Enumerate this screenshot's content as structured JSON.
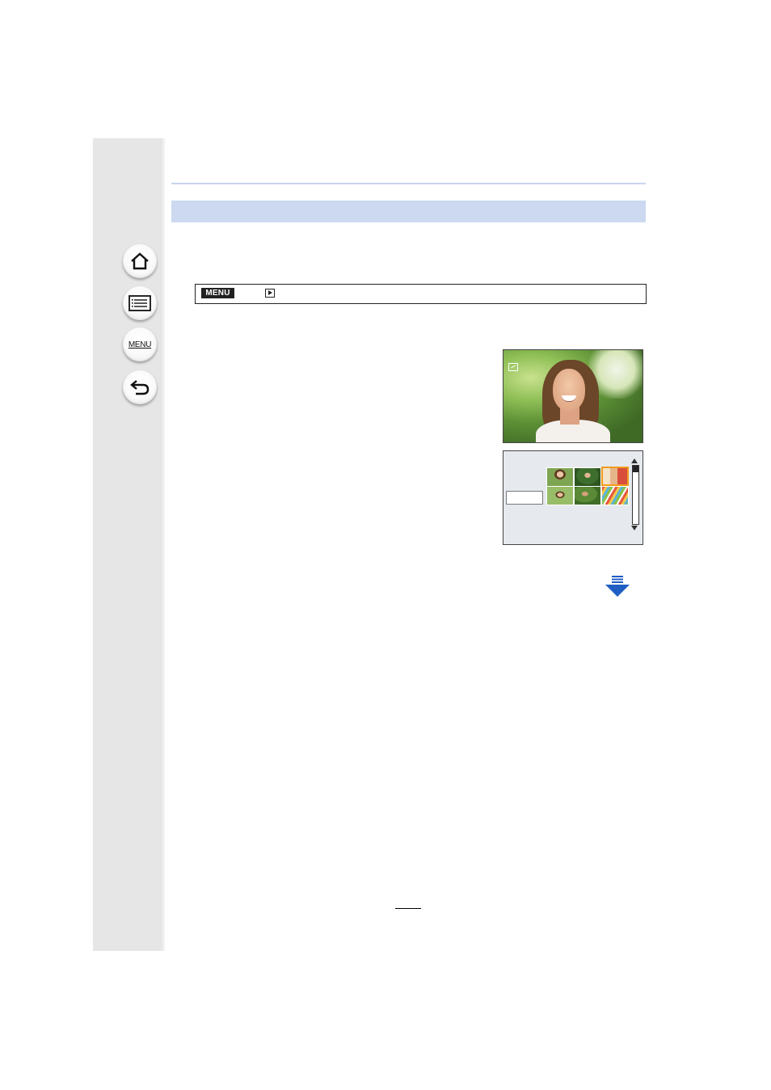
{
  "sidebar": {
    "buttons": [
      {
        "name": "home",
        "icon": "home-icon"
      },
      {
        "name": "contents",
        "icon": "list-icon"
      },
      {
        "name": "menu",
        "label": "MENU",
        "icon": "menu-list-icon"
      },
      {
        "name": "back",
        "icon": "back-arrow-icon"
      }
    ]
  },
  "menu_path": {
    "badge": "MENU",
    "mode_icon": "playback-icon"
  },
  "colors": {
    "section_bar": "#ccd9f1",
    "rule": "#c9d5ec",
    "sidebar": "#e6e6e6",
    "next_arrow": "#1f5fc4",
    "selection_frame": "#f19a1b"
  },
  "next_page": {
    "icon": "next-page-arrow-icon"
  }
}
